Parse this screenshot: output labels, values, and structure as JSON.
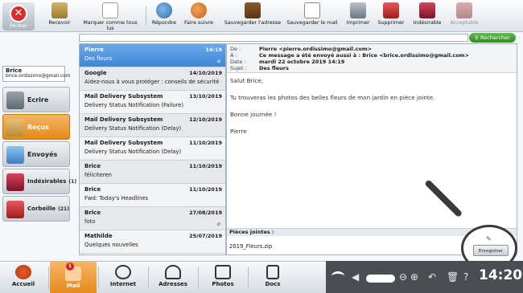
{
  "toolbar": {
    "close_label": "Fermer",
    "buttons": [
      {
        "label": "Recevoir",
        "icon": "receive-icon"
      },
      {
        "label": "Marquer comme tous lus",
        "icon": "mark-read-icon"
      },
      {
        "label": "Répondre",
        "icon": "reply-icon"
      },
      {
        "label": "Faire suivre",
        "icon": "forward-icon"
      },
      {
        "label": "Sauvegarder l'adresse",
        "icon": "address-book-icon"
      },
      {
        "label": "Sauvegarder le mail",
        "icon": "save-mail-icon"
      },
      {
        "label": "Imprimer",
        "icon": "printer-icon"
      },
      {
        "label": "Supprimer",
        "icon": "trash-icon"
      },
      {
        "label": "Indésirable",
        "icon": "spam-icon"
      },
      {
        "label": "Acceptable",
        "icon": "acceptable-icon"
      }
    ]
  },
  "search": {
    "placeholder": "",
    "button_label": "Rechercher"
  },
  "account": {
    "name": "Brice",
    "email": "brice.ordissimo@gmail.com"
  },
  "folders": [
    {
      "label": "Ecrire",
      "count": ""
    },
    {
      "label": "Reçus",
      "count": ""
    },
    {
      "label": "Envoyés",
      "count": ""
    },
    {
      "label": "Indésirables",
      "count": "(1)"
    },
    {
      "label": "Corbeille",
      "count": "(21)"
    }
  ],
  "messages": [
    {
      "from": "Pierre",
      "date": "14:19",
      "subject": "Des fleurs",
      "attachment": true
    },
    {
      "from": "Google",
      "date": "14/10/2019",
      "subject": "Aidez-nous à vous protéger : conseils de sécurité de",
      "attachment": false
    },
    {
      "from": "Mail Delivery Subsystem",
      "date": "13/10/2019",
      "subject": "Delivery Status Notification (Failure)",
      "attachment": false
    },
    {
      "from": "Mail Delivery Subsystem",
      "date": "12/10/2019",
      "subject": "Delivery Status Notification (Delay)",
      "attachment": false
    },
    {
      "from": "Mail Delivery Subsystem",
      "date": "11/10/2019",
      "subject": "Delivery Status Notification (Delay)",
      "attachment": false
    },
    {
      "from": "Brice",
      "date": "11/10/2019",
      "subject": "féliciteren",
      "attachment": false
    },
    {
      "from": "Brice",
      "date": "11/10/2019",
      "subject": "Fwd: Today's Headlines",
      "attachment": false
    },
    {
      "from": "Brice",
      "date": "27/08/2019",
      "subject": "foto",
      "attachment": true
    },
    {
      "from": "Mathilde",
      "date": "25/07/2019",
      "subject": "Quelques nouvelles",
      "attachment": false
    }
  ],
  "reader": {
    "from_key": "De :",
    "from_val": "Pierre <pierre.ordissimo@gmail.com>",
    "to_key": "À :",
    "to_val": "Ce message a été envoyé aussi à :  Brice  <brice.ordissimo@gmail.com>",
    "date_key": "Date :",
    "date_val": "mardi 22 octobre 2019 14:19",
    "subject_key": "Sujet :",
    "subject_val": "Des fleurs",
    "body": [
      "Salut Brice,",
      "Tu trouveras les photos des belles fleurs de mon jardin en pièce jointe.",
      "Bonne journée !",
      "Pierre"
    ],
    "attachments_title": "Pièces jointes :",
    "attachment_file": "2019_Fleurs.zip",
    "save_label": "Enregistrer"
  },
  "dock": {
    "apps": [
      {
        "label": "Accueil"
      },
      {
        "label": "Mail",
        "badge": "1"
      },
      {
        "label": "Internet"
      },
      {
        "label": "Adresses"
      },
      {
        "label": "Photos"
      },
      {
        "label": "Docs"
      }
    ],
    "clock": "14:20"
  }
}
